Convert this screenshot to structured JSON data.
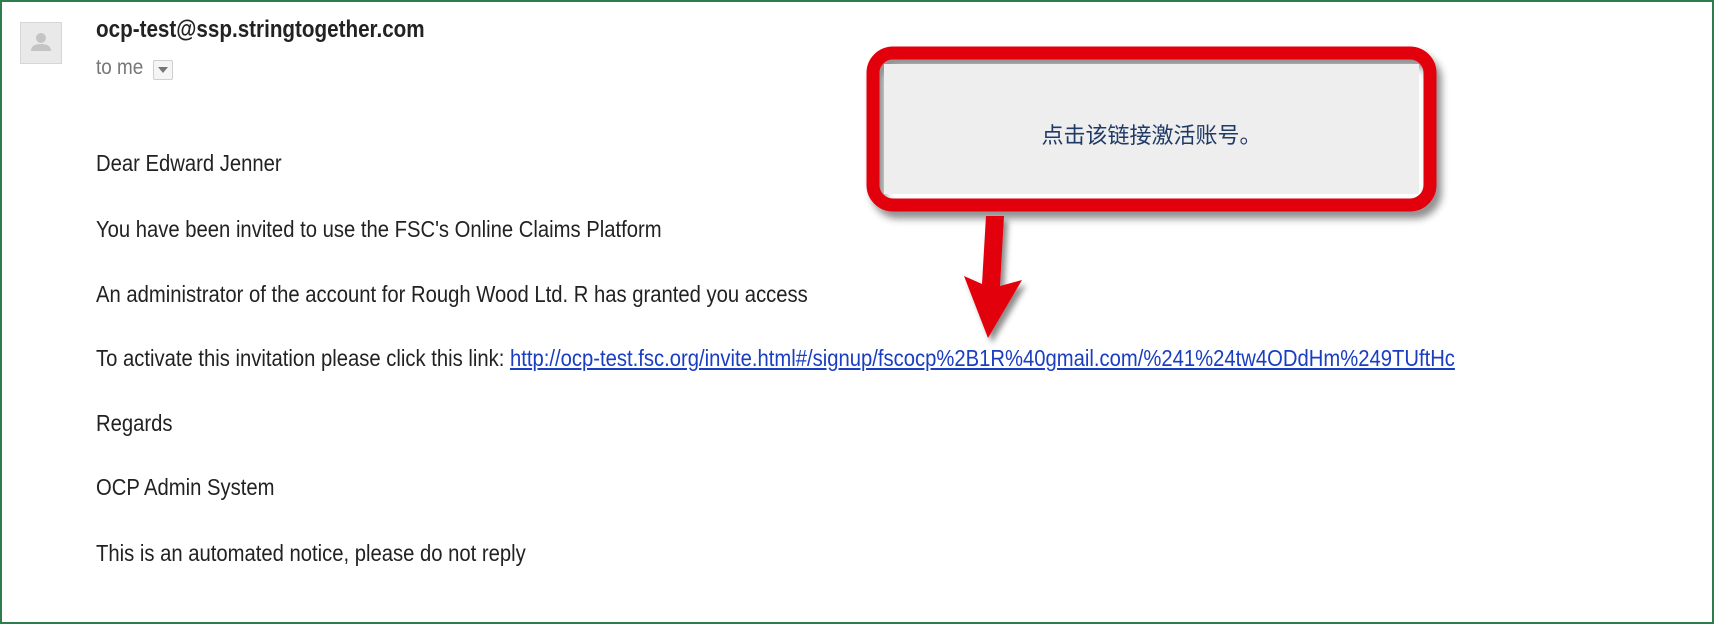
{
  "email": {
    "sender": "ocp-test@ssp.stringtogether.com",
    "recipient_label": "to me",
    "details_toggle_icon": "chevron-down-icon",
    "avatar_icon": "person-silhouette-icon",
    "greeting": "Dear Edward Jenner",
    "line_invited": "You have been invited to use the FSC's Online Claims Platform",
    "line_admin": "An administrator of the account for Rough Wood Ltd. R has granted you access",
    "activate_prefix": "To activate this invitation please click this link: ",
    "activate_link_text": "http://ocp-test.fsc.org/invite.html#/signup/fscocp%2B1R%40gmail.com/%241%24tw4ODdHm%249TUftHc",
    "regards": "Regards",
    "signature": "OCP Admin System",
    "notice": "This is an automated notice, please do not reply"
  },
  "callout": {
    "text": "点击该链接激活账号。",
    "border_color": "#e3000f",
    "arrow_color": "#e3000f"
  },
  "colors": {
    "frame_border": "#2e7d4f",
    "link": "#1a3dc1",
    "text": "#222222",
    "muted": "#777777"
  }
}
